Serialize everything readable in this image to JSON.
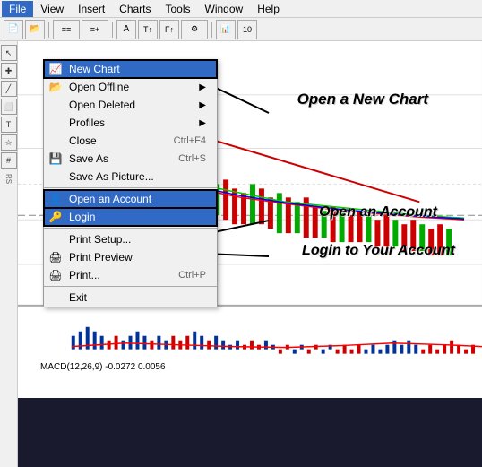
{
  "menubar": {
    "items": [
      "File",
      "View",
      "Insert",
      "Charts",
      "Tools",
      "Window",
      "Help"
    ]
  },
  "file_menu": {
    "items": [
      {
        "label": "New Chart",
        "shortcut": "",
        "has_submenu": false,
        "highlighted": true,
        "icon": "new-chart"
      },
      {
        "label": "Open Offline",
        "shortcut": "",
        "has_submenu": true,
        "highlighted": false,
        "icon": "open-offline"
      },
      {
        "label": "Open Deleted",
        "shortcut": "",
        "has_submenu": true,
        "highlighted": false,
        "icon": ""
      },
      {
        "label": "Profiles",
        "shortcut": "",
        "has_submenu": true,
        "highlighted": false,
        "icon": ""
      },
      {
        "label": "Close",
        "shortcut": "Ctrl+F4",
        "has_submenu": false,
        "highlighted": false,
        "icon": ""
      },
      {
        "label": "Save As",
        "shortcut": "Ctrl+S",
        "has_submenu": false,
        "highlighted": false,
        "icon": "save"
      },
      {
        "label": "Save As Picture...",
        "shortcut": "",
        "has_submenu": false,
        "highlighted": false,
        "icon": ""
      },
      {
        "label": "separator1",
        "type": "sep"
      },
      {
        "label": "Open an Account",
        "shortcut": "",
        "has_submenu": false,
        "highlighted": true,
        "icon": "account"
      },
      {
        "label": "Login",
        "shortcut": "",
        "has_submenu": false,
        "highlighted": true,
        "icon": "login"
      },
      {
        "label": "separator2",
        "type": "sep"
      },
      {
        "label": "Print Setup...",
        "shortcut": "",
        "has_submenu": false,
        "highlighted": false,
        "icon": ""
      },
      {
        "label": "Print Preview",
        "shortcut": "",
        "has_submenu": false,
        "highlighted": false,
        "icon": "print-preview"
      },
      {
        "label": "Print...",
        "shortcut": "Ctrl+P",
        "has_submenu": false,
        "highlighted": false,
        "icon": "print"
      },
      {
        "label": "separator3",
        "type": "sep"
      },
      {
        "label": "Exit",
        "shortcut": "",
        "has_submenu": false,
        "highlighted": false,
        "icon": ""
      }
    ]
  },
  "annotations": {
    "new_chart": "Open a New Chart",
    "open_account": "Open an Account",
    "login": "Login to Your Account"
  },
  "macd": {
    "label": "MACD(12,26,9) -0.0272 0.0056"
  },
  "colors": {
    "highlight": "#316ac5",
    "menu_bg": "#f0f0f0",
    "chart_bg": "#1a1a2e"
  }
}
